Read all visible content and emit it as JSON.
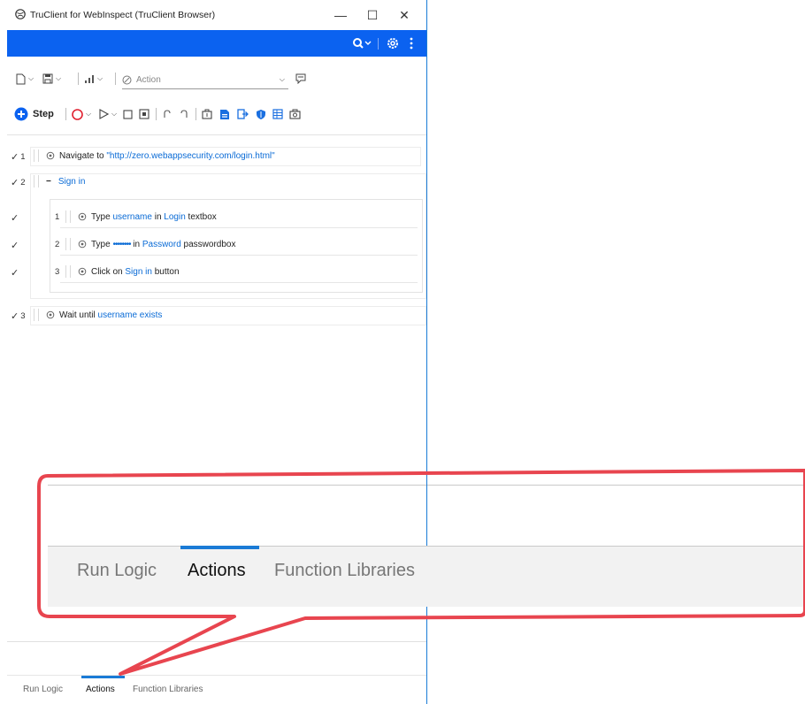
{
  "window": {
    "title": "TruClient for WebInspect (TruClient Browser)",
    "min_glyph": "—",
    "max_glyph": "☐",
    "close_glyph": "✕"
  },
  "toolbar": {
    "action_select_value": "Action",
    "step_button_label": "Step"
  },
  "steps": [
    {
      "number": "1",
      "verb": "Navigate to",
      "target": "\"http://zero.webappsecurity.com/login.html\""
    },
    {
      "number": "2",
      "group_title": "Sign in",
      "collapse_glyph": "−",
      "substeps": [
        {
          "number": "1",
          "verb": "Type",
          "value": "username",
          "mid": "in",
          "target": "Login",
          "suffix": "textbox"
        },
        {
          "number": "2",
          "verb": "Type",
          "value": "••••••••",
          "mid": "in",
          "target": "Password",
          "suffix": "passwordbox"
        },
        {
          "number": "3",
          "verb": "Click on",
          "target": "Sign in",
          "suffix": "button"
        }
      ]
    },
    {
      "number": "3",
      "verb": "Wait until",
      "target": "username exists"
    }
  ],
  "bottom_tabs": {
    "items": [
      "Run Logic",
      "Actions",
      "Function Libraries"
    ],
    "active": "Actions"
  },
  "colors": {
    "accent_blue": "#0b62f0",
    "link_blue": "#0a6bd6",
    "callout_red": "#e8454f"
  },
  "icons": [
    "globe-icon",
    "search-icon",
    "settings-icon",
    "more-icon",
    "new-file-icon",
    "save-icon",
    "chart-icon",
    "action-icon",
    "comment-icon",
    "add-step-icon",
    "record-icon",
    "play-icon",
    "stop-icon",
    "step-icon",
    "undo-icon",
    "redo-icon",
    "toolbox-icon",
    "script-icon",
    "export-icon",
    "shield-icon",
    "grid-icon",
    "camera-icon"
  ]
}
